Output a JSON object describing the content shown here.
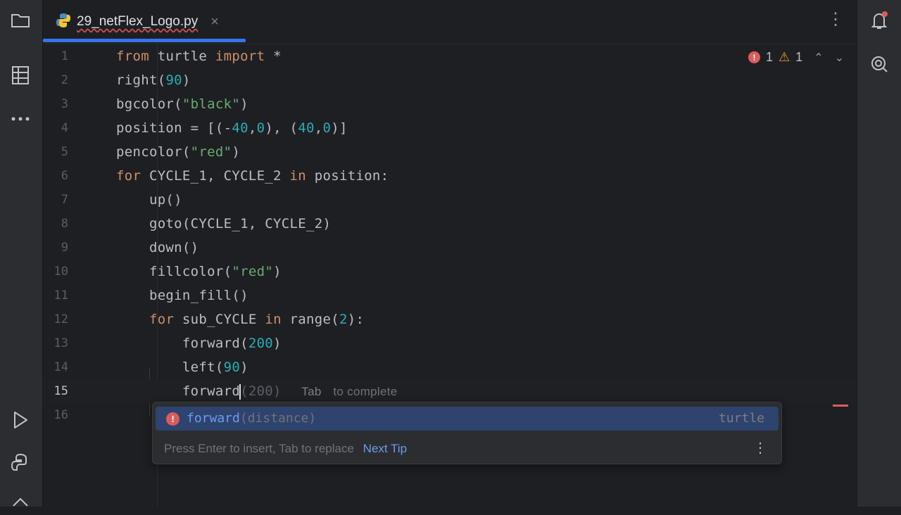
{
  "tab": {
    "filename": "29_netFlex_Logo.py",
    "close_glyph": "×"
  },
  "inspections": {
    "errors": "1",
    "warnings": "1"
  },
  "code_lines": [
    {
      "n": "1"
    },
    {
      "n": "2"
    },
    {
      "n": "3"
    },
    {
      "n": "4"
    },
    {
      "n": "5"
    },
    {
      "n": "6"
    },
    {
      "n": "7"
    },
    {
      "n": "8"
    },
    {
      "n": "9"
    },
    {
      "n": "10"
    },
    {
      "n": "11"
    },
    {
      "n": "12"
    },
    {
      "n": "13"
    },
    {
      "n": "14"
    },
    {
      "n": "15"
    },
    {
      "n": "16"
    }
  ],
  "inline_completion": {
    "ghost": "(200)",
    "hint_key": "Tab",
    "hint_text": "to complete"
  },
  "completion_popup": {
    "typed_prefix": "forward",
    "function_name": "forward",
    "params": "(distance)",
    "module": "turtle",
    "footer_text": "Press Enter to insert, Tab to replace",
    "footer_link": "Next Tip"
  },
  "colors": {
    "keyword": "#cf8e6d",
    "number": "#2aacb8",
    "string": "#6aab73",
    "accent": "#3574f0",
    "error": "#db5c5c"
  },
  "icons": [
    "folder-icon",
    "structure-icon",
    "more-icon",
    "run-icon",
    "python-console-icon",
    "notifications-icon",
    "ai-assistant-icon",
    "python-file-icon"
  ]
}
